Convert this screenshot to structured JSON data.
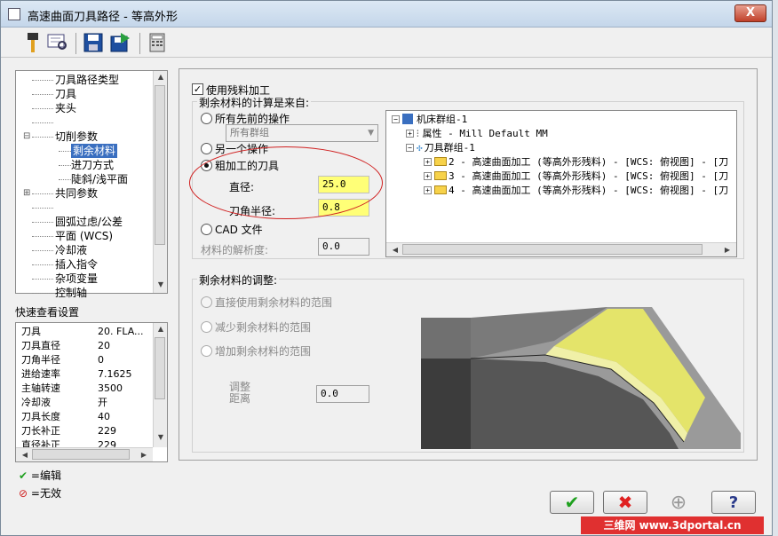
{
  "window": {
    "title": "高速曲面刀具路径 - 等高外形",
    "close_glyph": "X"
  },
  "toolbar": {
    "buttons": [
      "tool-icon",
      "preview-icon",
      "save-icon",
      "load-icon",
      "calculator-icon"
    ]
  },
  "tree": {
    "items": [
      {
        "label": "刀具路径类型",
        "indent": 2
      },
      {
        "label": "刀具",
        "indent": 2
      },
      {
        "label": "夹头",
        "indent": 2
      },
      {
        "label": "",
        "indent": 2
      },
      {
        "label": "切削参数",
        "indent": 2,
        "expander": "⊟"
      },
      {
        "label": "剩余材料",
        "indent": 3,
        "selected": true
      },
      {
        "label": "进刀方式",
        "indent": 3
      },
      {
        "label": "陡斜/浅平面",
        "indent": 3
      },
      {
        "label": "共同参数",
        "indent": 2,
        "expander": "⊞"
      },
      {
        "label": "",
        "indent": 2
      },
      {
        "label": "圆弧过虑/公差",
        "indent": 2
      },
      {
        "label": "平面 (WCS)",
        "indent": 2
      },
      {
        "label": "冷却液",
        "indent": 2
      },
      {
        "label": "插入指令",
        "indent": 2
      },
      {
        "label": "杂项变量",
        "indent": 2
      },
      {
        "label": "控制轴",
        "indent": 2
      }
    ]
  },
  "quick_settings": {
    "label": "快速查看设置",
    "rows": [
      {
        "key": "刀具",
        "value": "20. FLA..."
      },
      {
        "key": "刀具直径",
        "value": "20"
      },
      {
        "key": "刀角半径",
        "value": "0"
      },
      {
        "key": "进给速率",
        "value": "7.1625"
      },
      {
        "key": "主轴转速",
        "value": "3500"
      },
      {
        "key": "冷却液",
        "value": "开"
      },
      {
        "key": "刀具长度",
        "value": "40"
      },
      {
        "key": "刀长补正",
        "value": "229"
      },
      {
        "key": "直径补正",
        "value": "229"
      }
    ]
  },
  "legend": {
    "edit_label": "=编辑",
    "invalid_label": "=无效"
  },
  "rest_material": {
    "use_rest_label": "使用残料加工",
    "source_heading": "剩余材料的计算是来自:",
    "opt_all_prev": "所有先前的操作",
    "group_select": "所有群组",
    "opt_other_op": "另一个操作",
    "opt_rough_tool": "粗加工的刀具",
    "diameter_label": "直径:",
    "diameter_value": "25.0",
    "corner_radius_label": "刀角半径:",
    "corner_radius_value": "0.8",
    "opt_cad_file": "CAD 文件",
    "resolution_label": "材料的解析度:",
    "resolution_value": "0.0"
  },
  "ops_tree": {
    "machine_group": "机床群组-1",
    "properties": "属性 - Mill Default MM",
    "tool_group": "刀具群组-1",
    "operations": [
      "2 - 高速曲面加工 (等高外形残料) - [WCS: 俯视图] - [刀",
      "3 - 高速曲面加工 (等高外形残料) - [WCS: 俯视图] - [刀",
      "4 - 高速曲面加工 (等高外形残料) - [WCS: 俯视图] - [刀"
    ]
  },
  "adjust": {
    "heading": "剩余材料的调整:",
    "opt_direct": "直接使用剩余材料的范围",
    "opt_reduce": "减少剩余材料的范围",
    "opt_increase": "增加剩余材料的范围",
    "distance_label_1": "调整",
    "distance_label_2": "距离",
    "distance_value": "0.0"
  },
  "buttons": {
    "ok": "ok-check-icon",
    "cancel": "cancel-x-icon",
    "add": "add-plus-icon",
    "help": "help-question-icon"
  },
  "watermark": {
    "text": "三维网 www.3dportal.cn"
  },
  "colors": {
    "highlight": "#ffff77",
    "selection": "#3a6fc0",
    "ellipse": "#d02020"
  }
}
